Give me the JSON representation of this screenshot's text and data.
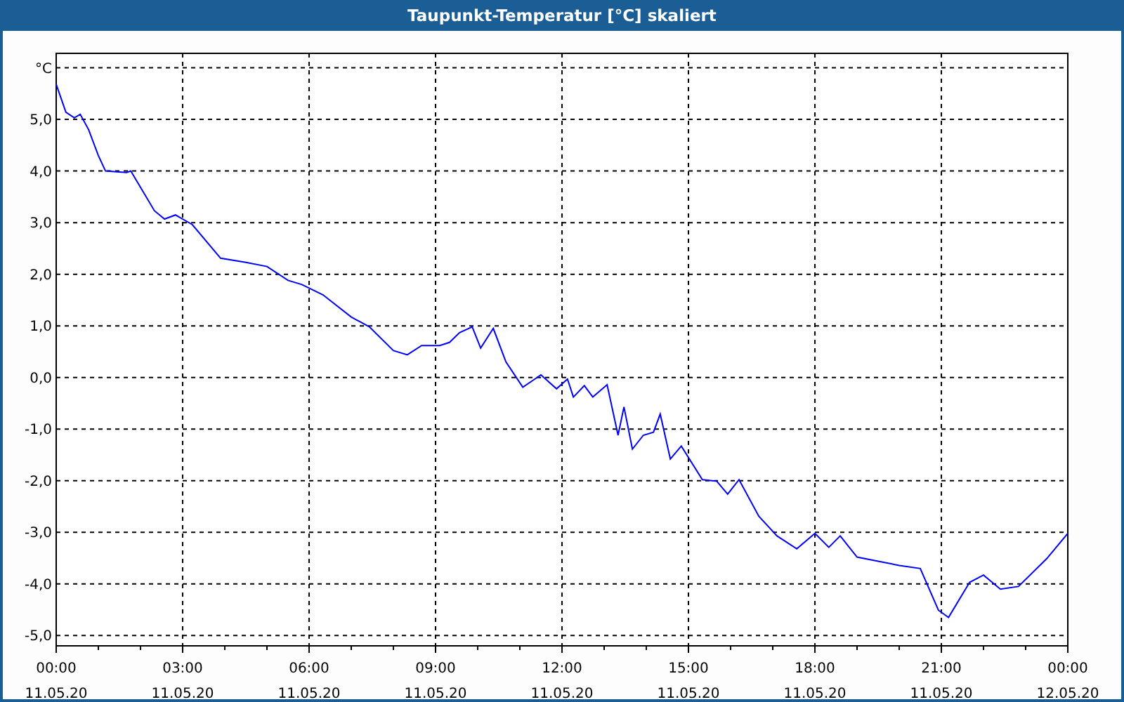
{
  "window": {
    "title": "Taupunkt-Temperatur [°C] skaliert"
  },
  "chart": {
    "chart_data": {
      "type": "line",
      "grid": true,
      "xlim": [
        0,
        24
      ],
      "ylim": [
        -5.2,
        6.28
      ],
      "xticks": [
        {
          "value": 0,
          "label": "00:00"
        },
        {
          "value": 3,
          "label": "03:00"
        },
        {
          "value": 6,
          "label": "06:00"
        },
        {
          "value": 9,
          "label": "09:00"
        },
        {
          "value": 12,
          "label": "12:00"
        },
        {
          "value": 15,
          "label": "15:00"
        },
        {
          "value": 18,
          "label": "18:00"
        },
        {
          "value": 21,
          "label": "21:00"
        },
        {
          "value": 24,
          "label": "00:00"
        }
      ],
      "yticks": [
        {
          "value": 6,
          "label": "°C"
        },
        {
          "value": 5,
          "label": "5,0"
        },
        {
          "value": 4,
          "label": "4,0"
        },
        {
          "value": 3,
          "label": "3,0"
        },
        {
          "value": 2,
          "label": "2,0"
        },
        {
          "value": 1,
          "label": "1,0"
        },
        {
          "value": 0,
          "label": "0,0"
        },
        {
          "value": -1,
          "label": "-1,0"
        },
        {
          "value": -2,
          "label": "-2,0"
        },
        {
          "value": -3,
          "label": "-3,0"
        },
        {
          "value": -4,
          "label": "-4,0"
        },
        {
          "value": -5,
          "label": "-5,0"
        }
      ],
      "x": [
        0,
        0.23,
        0.43,
        0.57,
        0.77,
        1.0,
        1.17,
        1.67,
        1.77,
        1.93,
        2.33,
        2.57,
        2.83,
        3.23,
        3.9,
        4.5,
        5.0,
        5.5,
        5.83,
        6.33,
        7.0,
        7.43,
        8.0,
        8.33,
        8.67,
        9.1,
        9.33,
        9.57,
        9.87,
        10.07,
        10.37,
        10.67,
        11.07,
        11.5,
        11.87,
        12.13,
        12.27,
        12.53,
        12.73,
        13.07,
        13.33,
        13.47,
        13.67,
        13.93,
        14.17,
        14.33,
        14.57,
        14.83,
        15.33,
        15.67,
        15.93,
        16.2,
        16.67,
        17.1,
        17.57,
        18.0,
        18.33,
        18.6,
        19.0,
        19.5,
        20.0,
        20.5,
        20.93,
        21.17,
        21.67,
        22.0,
        22.4,
        22.83,
        23.5,
        24.0
      ],
      "series": [
        {
          "color": "#0000ff",
          "values": [
            5.68,
            5.14,
            5.03,
            5.1,
            4.8,
            4.3,
            4.0,
            3.97,
            4.0,
            3.78,
            3.23,
            3.07,
            3.15,
            2.96,
            2.31,
            2.23,
            2.15,
            1.88,
            1.8,
            1.6,
            1.17,
            0.98,
            0.52,
            0.44,
            0.62,
            0.62,
            0.68,
            0.87,
            0.98,
            0.57,
            0.95,
            0.3,
            -0.19,
            0.05,
            -0.22,
            -0.03,
            -0.38,
            -0.16,
            -0.38,
            -0.14,
            -1.12,
            -0.57,
            -1.39,
            -1.12,
            -1.06,
            -0.71,
            -1.58,
            -1.33,
            -1.98,
            -2.01,
            -2.26,
            -1.98,
            -2.69,
            -3.07,
            -3.32,
            -3.02,
            -3.29,
            -3.07,
            -3.48,
            -3.56,
            -3.64,
            -3.7,
            -4.51,
            -4.65,
            -3.97,
            -3.83,
            -4.1,
            -4.05,
            -3.51,
            -3.02
          ]
        }
      ]
    },
    "x_dates": [
      "11.05.20",
      "11.05.20",
      "11.05.20",
      "11.05.20",
      "11.05.20",
      "11.05.20",
      "11.05.20",
      "11.05.20",
      "12.05.20"
    ]
  }
}
